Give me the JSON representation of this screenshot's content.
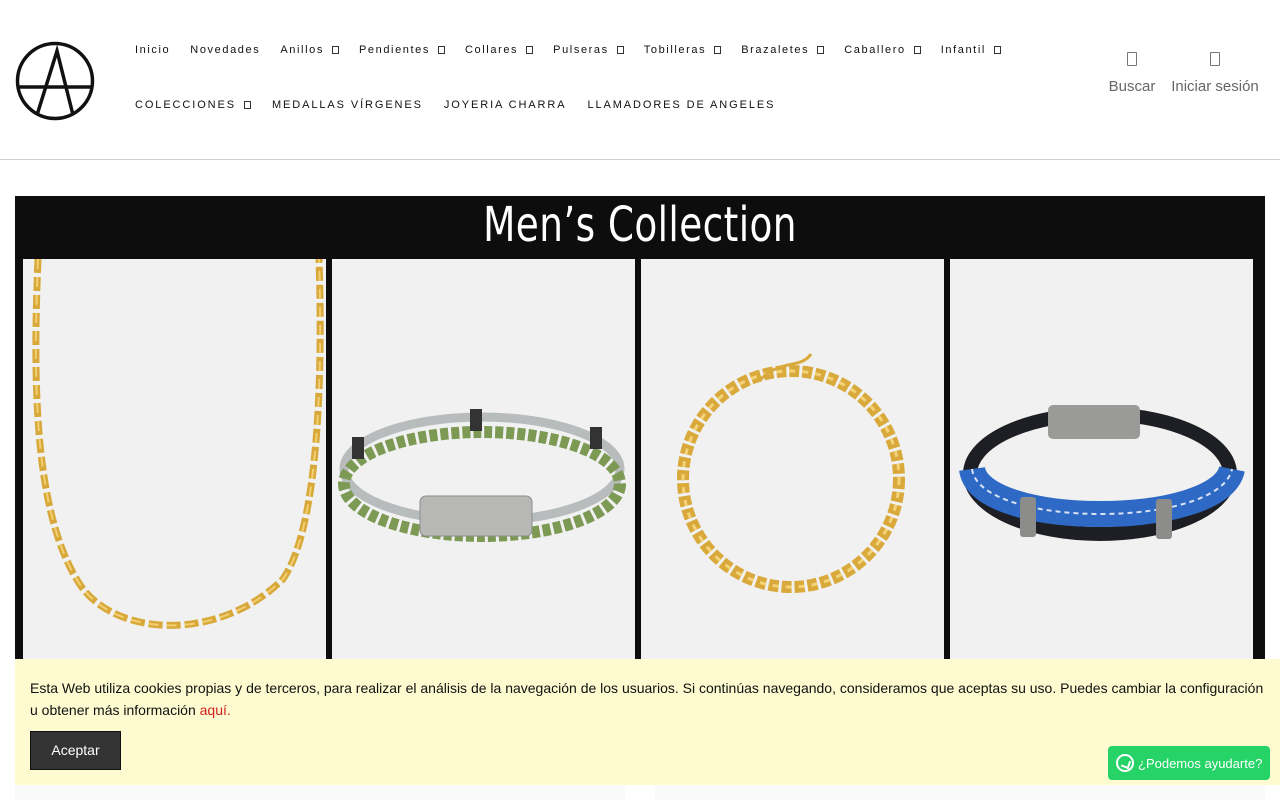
{
  "header": {
    "nav_row1": [
      {
        "label": "Inicio",
        "dropdown": false
      },
      {
        "label": "Novedades",
        "dropdown": false
      },
      {
        "label": "Anillos",
        "dropdown": true
      },
      {
        "label": "Pendientes",
        "dropdown": true
      },
      {
        "label": "Collares",
        "dropdown": true
      },
      {
        "label": "Pulseras",
        "dropdown": true
      },
      {
        "label": "Tobilleras",
        "dropdown": true
      },
      {
        "label": "Brazaletes",
        "dropdown": true
      },
      {
        "label": "Caballero",
        "dropdown": true
      },
      {
        "label": "Infantil",
        "dropdown": true
      }
    ],
    "nav_row2": [
      {
        "label": "COLECCIONES",
        "dropdown": true
      },
      {
        "label": "MEDALLAS VÍRGENES",
        "dropdown": false
      },
      {
        "label": "JOYERIA CHARRA",
        "dropdown": false
      },
      {
        "label": "LLAMADORES DE ANGELES",
        "dropdown": false
      }
    ],
    "search_label": "Buscar",
    "login_label": "Iniciar sesión"
  },
  "collection": {
    "title": "Men’s Collection",
    "products": [
      {
        "icon": "gold-figaro-chain-image"
      },
      {
        "icon": "green-braided-bracelet-image"
      },
      {
        "icon": "gold-byzantine-bracelet-image"
      },
      {
        "icon": "blue-leather-bracelet-image"
      }
    ]
  },
  "cookie": {
    "text": "Esta Web utiliza cookies propias y de terceros, para realizar el análisis de la navegación de los usuarios. Si continúas navegando, consideramos que aceptas su uso. Puedes cambiar la configuración u obtener más información ",
    "link": "aquí.",
    "accept": "Aceptar"
  },
  "whatsapp": {
    "label": "¿Podemos ayudarte?"
  },
  "colors": {
    "cookie_bg": "#fdfbcf",
    "link": "#d21f1f",
    "whatsapp": "#25d366",
    "banner": "#0d0d0d"
  }
}
